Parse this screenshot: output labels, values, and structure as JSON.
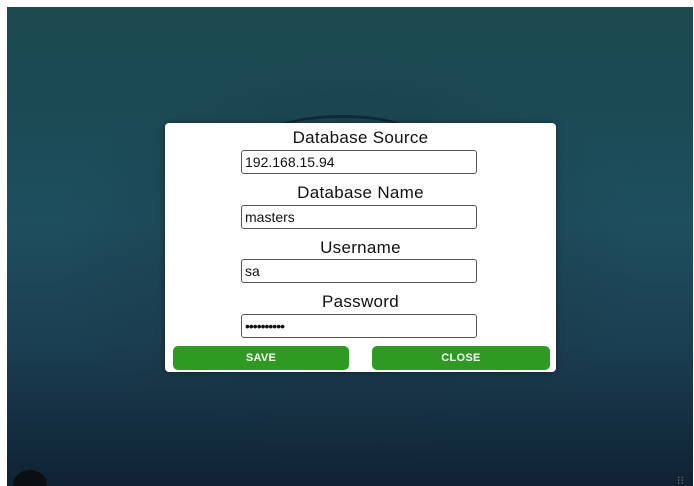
{
  "dialog": {
    "fields": [
      {
        "label": "Database Source",
        "value": "192.168.15.94"
      },
      {
        "label": "Database Name",
        "value": "masters"
      },
      {
        "label": "Username",
        "value": "sa"
      },
      {
        "label": "Password",
        "value": "••••••••••"
      }
    ],
    "buttons": {
      "save_label": "SAVE",
      "close_label": "CLOSE"
    }
  },
  "colors": {
    "button": "#2e9a22",
    "dialog_bg": "#ffffff",
    "screen_bg": "#1d4a56"
  },
  "icons": {
    "bottom_left": "avatar-icon",
    "bottom_right": "nav-icon"
  }
}
